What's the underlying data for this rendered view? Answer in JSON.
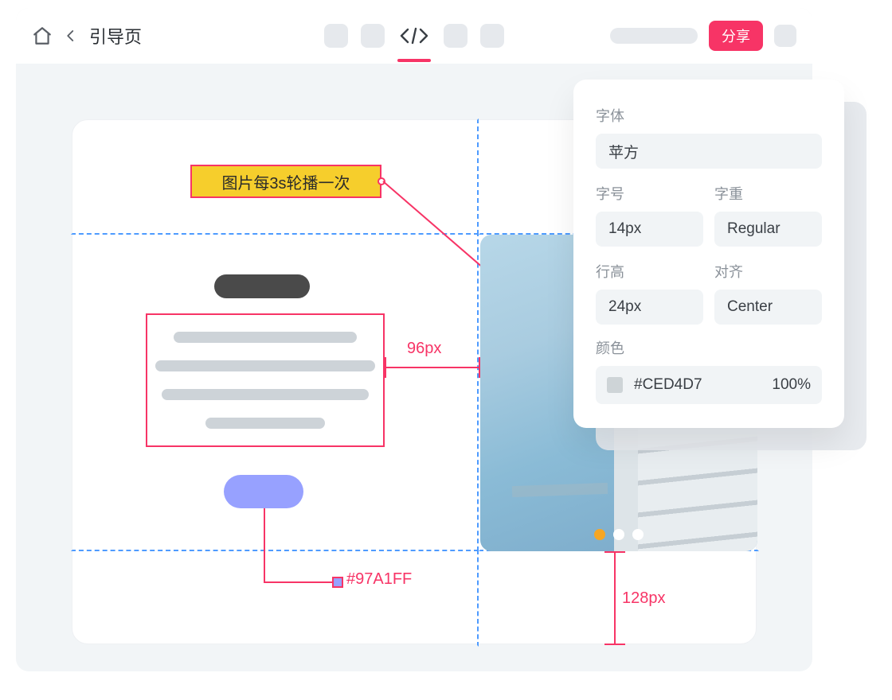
{
  "header": {
    "page_title": "引导页",
    "share_label": "分享"
  },
  "annotations": {
    "carousel_note": "图片每3s轮播一次",
    "spacing_96": "96px",
    "spacing_128": "128px",
    "button_color_label": "#97A1FF"
  },
  "carousel": {
    "dot_count": 3,
    "active_index": 0
  },
  "inspector": {
    "font_label": "字体",
    "font_value": "苹方",
    "size_label": "字号",
    "size_value": "14px",
    "weight_label": "字重",
    "weight_value": "Regular",
    "lineheight_label": "行高",
    "lineheight_value": "24px",
    "align_label": "对齐",
    "align_value": "Center",
    "color_label": "颜色",
    "color_hex": "#CED4D7",
    "color_opacity": "100%"
  },
  "colors": {
    "accent": "#F73466",
    "button": "#97A1FF",
    "guide": "#4E9BFF",
    "note_bg": "#F6CE2C"
  }
}
